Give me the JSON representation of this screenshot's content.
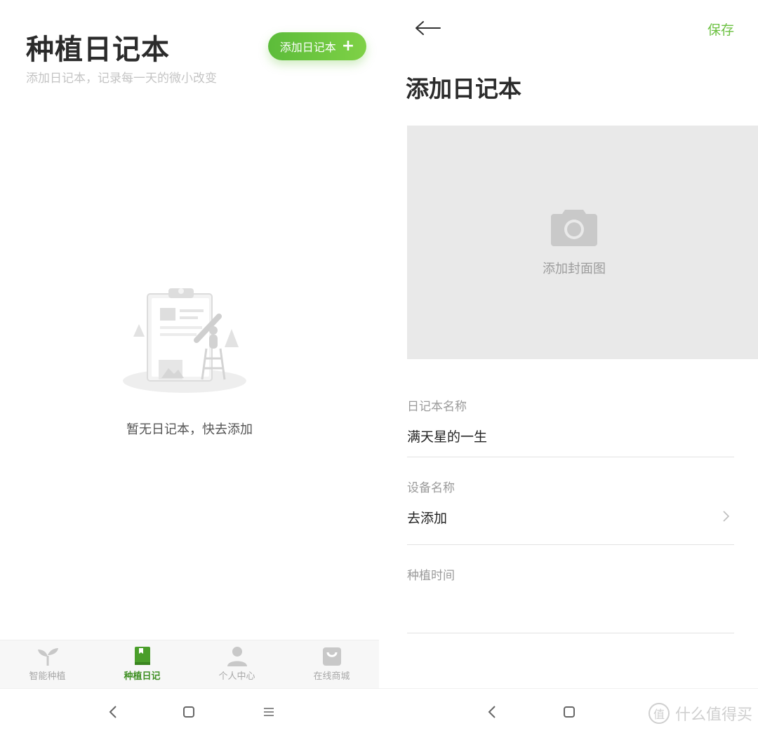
{
  "left": {
    "title": "种植日记本",
    "subtitle": "添加日记本，记录每一天的微小改变",
    "add_button_label": "添加日记本",
    "add_button_icon": "plus-icon",
    "empty_message": "暂无日记本，快去添加",
    "tabs": [
      {
        "label": "智能种植",
        "icon": "sprout-icon",
        "active": false
      },
      {
        "label": "种植日记",
        "icon": "notebook-icon",
        "active": true
      },
      {
        "label": "个人中心",
        "icon": "person-icon",
        "active": false
      },
      {
        "label": "在线商城",
        "icon": "shopping-bag-icon",
        "active": false
      }
    ]
  },
  "right": {
    "save_label": "保存",
    "title": "添加日记本",
    "cover_label": "添加封面图",
    "fields": [
      {
        "label": "日记本名称",
        "value": "满天星的一生"
      },
      {
        "label": "设备名称",
        "value": "去添加"
      },
      {
        "label": "种植时间",
        "value": ""
      }
    ]
  },
  "watermark": {
    "text": "什么值得买",
    "icon_text": "值"
  },
  "colors": {
    "accent": "#6cc142",
    "active_tab": "#3f8f23",
    "cover_bg": "#e9e9e9"
  }
}
